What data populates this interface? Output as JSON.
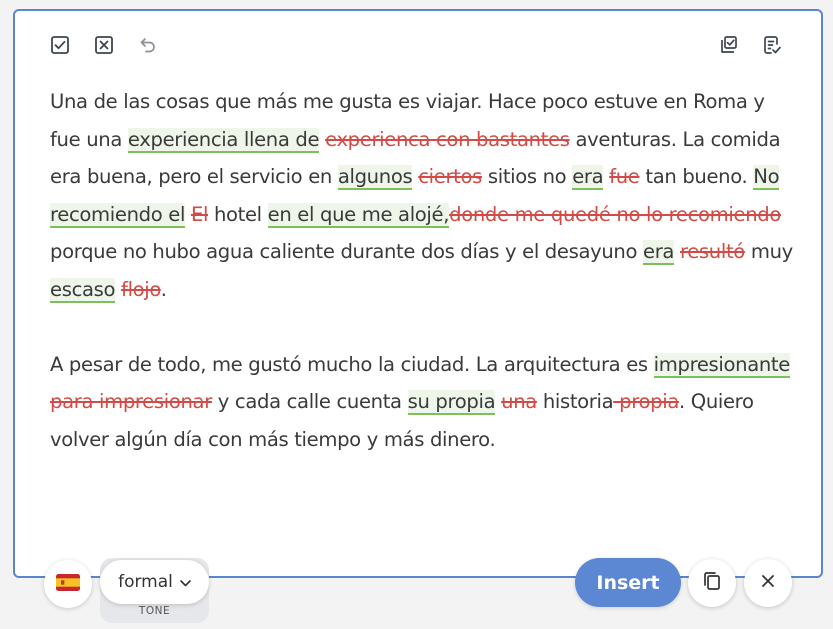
{
  "toolbar": {
    "left_icons": [
      "accept-all-icon",
      "reject-all-icon",
      "undo-icon"
    ],
    "right_icons": [
      "review-changes-icon",
      "notes-icon"
    ]
  },
  "paragraphs": [
    [
      {
        "t": "Una de las cosas que más me gusta es viajar. Hace poco estuve en Roma y fue una "
      },
      {
        "t": "experiencia llena de",
        "k": "ins"
      },
      {
        "t": " "
      },
      {
        "t": "experienca con bastantes",
        "k": "del"
      },
      {
        "t": " aventuras. La comida era buena, pero el servicio en "
      },
      {
        "t": "algunos",
        "k": "ins"
      },
      {
        "t": " "
      },
      {
        "t": "ciertos",
        "k": "del"
      },
      {
        "t": " sitios no "
      },
      {
        "t": "era",
        "k": "ins"
      },
      {
        "t": " "
      },
      {
        "t": "fue",
        "k": "del"
      },
      {
        "t": " tan bueno. "
      },
      {
        "t": "No recomiendo el",
        "k": "ins"
      },
      {
        "t": " "
      },
      {
        "t": "El",
        "k": "del"
      },
      {
        "t": " hotel "
      },
      {
        "t": "en el que me alojé,",
        "k": "ins"
      },
      {
        "t": "donde me quedé no lo recomiendo",
        "k": "del"
      },
      {
        "t": " porque no hubo agua caliente durante dos días y el desayuno "
      },
      {
        "t": "era",
        "k": "ins"
      },
      {
        "t": " "
      },
      {
        "t": "resultó",
        "k": "del"
      },
      {
        "t": " muy "
      },
      {
        "t": "escaso",
        "k": "ins"
      },
      {
        "t": " "
      },
      {
        "t": "flojo",
        "k": "del"
      },
      {
        "t": "."
      }
    ],
    [
      {
        "t": "A pesar de todo, me gustó mucho la ciudad. La arquitectura es "
      },
      {
        "t": "impresionante",
        "k": "ins"
      },
      {
        "t": " "
      },
      {
        "t": "para impresionar",
        "k": "del"
      },
      {
        "t": " y cada calle cuenta "
      },
      {
        "t": "su propia",
        "k": "ins"
      },
      {
        "t": " "
      },
      {
        "t": "una",
        "k": "del"
      },
      {
        "t": " historia"
      },
      {
        "t": " propia",
        "k": "del"
      },
      {
        "t": ". Quiero volver algún día con más tiempo y más dinero."
      }
    ]
  ],
  "footer": {
    "language_flag_icon": "spain-flag-icon",
    "tone_value": "formal",
    "tone_label": "TONE",
    "insert_label": "Insert",
    "copy_icon": "copy-icon",
    "close_icon": "close-icon"
  },
  "colors": {
    "accent": "#5b87d3",
    "insert_highlight": "#edf6e8",
    "insert_underline": "#7cbf5c",
    "deletion": "#d24b46"
  }
}
